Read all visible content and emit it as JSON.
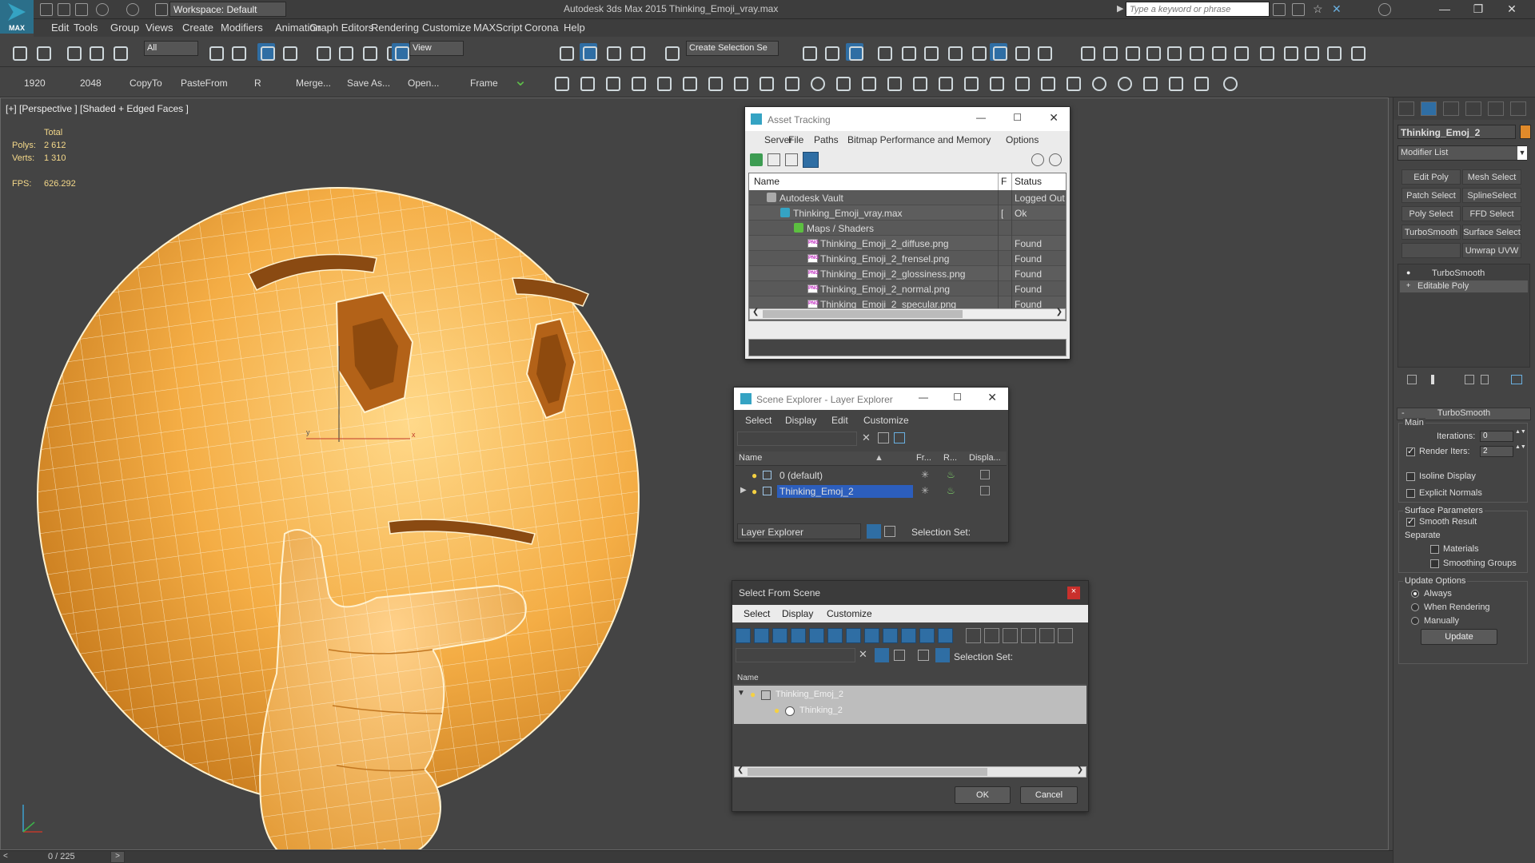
{
  "app": {
    "logo_label": "MAX",
    "workspace": "Workspace: Default",
    "title": "Autodesk 3ds Max  2015     Thinking_Emoji_vray.max",
    "search_placeholder": "Type a keyword or phrase"
  },
  "menubar": [
    "Edit",
    "Tools",
    "Group",
    "Views",
    "Create",
    "Modifiers",
    "Animation",
    "Graph Editors",
    "Rendering",
    "Customize",
    "MAXScript",
    "Corona",
    "Help"
  ],
  "toolbar1": {
    "selection_filter": "All",
    "ref_coord": "View",
    "named_selection": "Create Selection Se"
  },
  "toolbar2": {
    "labels": [
      "1920",
      "2048",
      "CopyTo",
      "PasteFrom",
      "R",
      "Merge...",
      "Save As...",
      "Open...",
      "Frame"
    ]
  },
  "viewport": {
    "label": "[+] [Perspective ] [Shaded + Edged Faces ]",
    "stats": {
      "total_label": "Total",
      "polys_label": "Polys:",
      "polys": "2 612",
      "verts_label": "Verts:",
      "verts": "1 310",
      "fps_label": "FPS:",
      "fps": "626.292"
    },
    "axis_x": "x",
    "axis_y": "y"
  },
  "asset_tracking": {
    "title": "Asset Tracking",
    "menu": [
      "Server",
      "File",
      "Paths",
      "Bitmap Performance and Memory",
      "Options"
    ],
    "columns": [
      "Name",
      "F",
      "Status"
    ],
    "rows": [
      {
        "name": "Autodesk Vault",
        "f": "",
        "status": "Logged Out",
        "indent": 0,
        "icon": "vault-icon"
      },
      {
        "name": "Thinking_Emoji_vray.max",
        "f": "[",
        "status": "Ok",
        "indent": 1,
        "icon": "max-file-icon"
      },
      {
        "name": "Maps / Shaders",
        "f": "",
        "status": "",
        "indent": 2,
        "icon": "maps-icon"
      },
      {
        "name": "Thinking_Emoji_2_diffuse.png",
        "f": "",
        "status": "Found",
        "indent": 3,
        "icon": "png-icon"
      },
      {
        "name": "Thinking_Emoji_2_frensel.png",
        "f": "",
        "status": "Found",
        "indent": 3,
        "icon": "png-icon"
      },
      {
        "name": "Thinking_Emoji_2_glossiness.png",
        "f": "",
        "status": "Found",
        "indent": 3,
        "icon": "png-icon"
      },
      {
        "name": "Thinking_Emoji_2_normal.png",
        "f": "",
        "status": "Found",
        "indent": 3,
        "icon": "png-icon"
      },
      {
        "name": "Thinking_Emoji_2_specular.png",
        "f": "",
        "status": "Found",
        "indent": 3,
        "icon": "png-icon"
      }
    ],
    "png_tag": "PNG"
  },
  "scene_explorer": {
    "title": "Scene Explorer - Layer Explorer",
    "menu": [
      "Select",
      "Display",
      "Edit",
      "Customize"
    ],
    "columns": [
      "Name",
      "Fr...",
      "R...",
      "Displa..."
    ],
    "rows": [
      {
        "name": "0 (default)",
        "selected": false
      },
      {
        "name": "Thinking_Emoj_2",
        "selected": true
      }
    ],
    "explorer_dropdown": "Layer Explorer",
    "selection_set_label": "Selection Set:"
  },
  "select_from_scene": {
    "title": "Select From Scene",
    "menu": [
      "Select",
      "Display",
      "Customize"
    ],
    "selection_set_label": "Selection Set:",
    "column": "Name",
    "rows": [
      {
        "name": "Thinking_Emoj_2"
      },
      {
        "name": "Thinking_2"
      }
    ],
    "ok": "OK",
    "cancel": "Cancel"
  },
  "command_panel": {
    "object_name": "Thinking_Emoj_2",
    "object_color": "#e08a2a",
    "modifier_list": "Modifier List",
    "modifier_buttons": [
      "Edit Poly",
      "Mesh Select",
      "Patch Select",
      "SplineSelect",
      "Poly Select",
      "FFD Select",
      "TurboSmooth",
      "Surface Select",
      "",
      "Unwrap UVW"
    ],
    "stack": [
      "TurboSmooth",
      "Editable Poly"
    ],
    "rollout_title": "TurboSmooth",
    "main_label": "Main",
    "iterations_label": "Iterations:",
    "iterations": "0",
    "render_iters_label": "Render Iters:",
    "render_iters": "2",
    "isoline": "Isoline Display",
    "explicit_normals": "Explicit Normals",
    "surface_params": "Surface Parameters",
    "smooth_result": "Smooth Result",
    "separate": "Separate",
    "materials": "Materials",
    "smoothing_groups": "Smoothing Groups",
    "update_options": "Update Options",
    "always": "Always",
    "when_rendering": "When Rendering",
    "manually": "Manually",
    "update": "Update"
  },
  "status": {
    "frame": "0 / 225"
  },
  "colors": {
    "emoji": "#f2a93b",
    "accent_blue": "#2f6ea4",
    "selection": "#2c5ebd"
  }
}
